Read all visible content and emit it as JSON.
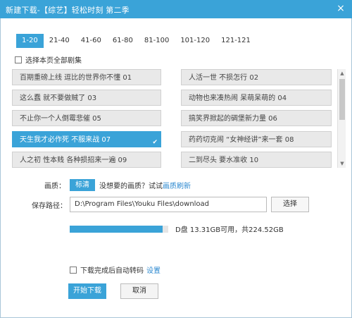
{
  "window": {
    "title": "新建下载-【综艺】轻松时刻 第二季",
    "close_label": "×"
  },
  "tabs": [
    {
      "label": "1-20",
      "active": true
    },
    {
      "label": "21-40"
    },
    {
      "label": "41-60"
    },
    {
      "label": "61-80"
    },
    {
      "label": "81-100"
    },
    {
      "label": "101-120"
    },
    {
      "label": "121-121"
    }
  ],
  "select_all": {
    "label": "选择本页全部剧集",
    "checked": false
  },
  "episodes": {
    "left": [
      "百期重磅上线 逗比的世界你不懂 01",
      "这么蠢 就不要做贼了 03",
      "不止你一个人倒霉悲催 05",
      "天生我才必作死 不服来战 07",
      "人之初 性本贱 各种损招来一遍 09"
    ],
    "right": [
      "人活一世 不损怎行 02",
      "动物也来凑热闹 呆萌呆萌的 04",
      "搞笑界掀起的碉堡新力量 06",
      "药药切克闹 “女神经讲”来一套 08",
      "二到尽头 要水准收 10"
    ],
    "selected": "天生我才必作死 不服来战 07",
    "selected_mark": "✔"
  },
  "scrollbar": {
    "up_icon": "▲",
    "down_icon": "▼"
  },
  "quality": {
    "label": "画质：",
    "selected": "标清",
    "hint": "没想要的画质？试试",
    "link": "画质刷新"
  },
  "save_path": {
    "label": "保存路径：",
    "value": "D:\\Program Files\\Youku Files\\download",
    "browse_label": "选择"
  },
  "disk": {
    "text": "D盘 13.31GB可用，共224.52GB",
    "used_fraction": 0.94,
    "color": "#3aa3d8"
  },
  "auto_transcode": {
    "label": "下载完成后自动转码",
    "link": "设置",
    "checked": false
  },
  "actions": {
    "start_label": "开始下载",
    "cancel_label": "取消"
  },
  "colors": {
    "accent": "#3aa3d8",
    "link": "#2e8ad0"
  }
}
